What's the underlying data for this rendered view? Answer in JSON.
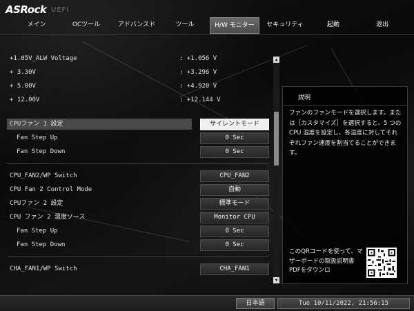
{
  "brand": {
    "logo": "ASRock",
    "sub": "UEFI"
  },
  "menu": [
    {
      "label": "メイン",
      "active": false
    },
    {
      "label": "OCツール",
      "active": false
    },
    {
      "label": "アドバンスド",
      "active": false
    },
    {
      "label": "ツール",
      "active": false
    },
    {
      "label": "H/W モニター",
      "active": true
    },
    {
      "label": "セキュリティ",
      "active": false
    },
    {
      "label": "起動",
      "active": false
    },
    {
      "label": "退出",
      "active": false
    }
  ],
  "voltages": [
    {
      "label": "+1.05V_ALW Voltage",
      "value": ": +1.056 V"
    },
    {
      "label": "+ 3.30V",
      "value": ": +3.296 V"
    },
    {
      "label": "+ 5.00V",
      "value": ": +4.920 V"
    },
    {
      "label": "+ 12.00V",
      "value": ": +12.144 V"
    }
  ],
  "settings": [
    {
      "label": "CPUファン 1 設定",
      "value": "サイレントモード",
      "indent": false,
      "selected": true
    },
    {
      "label": "Fan Step Up",
      "value": "0 Sec",
      "indent": true,
      "selected": false
    },
    {
      "label": "Fan Step Down",
      "value": "0 Sec",
      "indent": true,
      "selected": false
    },
    {
      "label": "CPU_FAN2/WP Switch",
      "value": "CPU_FAN2",
      "indent": false,
      "selected": false
    },
    {
      "label": "CPU Fan 2 Control Mode",
      "value": "自動",
      "indent": false,
      "selected": false
    },
    {
      "label": "CPUファン 2 設定",
      "value": "標準モード",
      "indent": false,
      "selected": false
    },
    {
      "label": "CPU ファン 2 温度ソース",
      "value": "Monitor CPU",
      "indent": false,
      "selected": false
    },
    {
      "label": "Fan Step Up",
      "value": "0 Sec",
      "indent": true,
      "selected": false
    },
    {
      "label": "Fan Step Down",
      "value": "0 Sec",
      "indent": true,
      "selected": false
    },
    {
      "label": "CHA_FAN1/WP Switch",
      "value": "CHA_FAN1",
      "indent": false,
      "selected": false
    }
  ],
  "help": {
    "title": "説明",
    "text": "ファンのファンモードを選択します。または［カスタマイズ］を選択すると、5 つの CPU 温度を設定し、各温度に対してそれぞれファン速度を割当てることができます。",
    "qr_text": "このQRコードを使って、マザーボードの取扱説明書PDFをダウンロ"
  },
  "footer": {
    "language": "日本語",
    "datetime": "Tue 10/11/2022, 21:56:15"
  },
  "icons": {
    "scroll_up": "up-arrow-icon",
    "scroll_down": "down-arrow-icon",
    "qr": "qr-code-icon"
  },
  "colors": {
    "selected_bg": "#efefef",
    "tab_active": "#5a5a5a"
  }
}
